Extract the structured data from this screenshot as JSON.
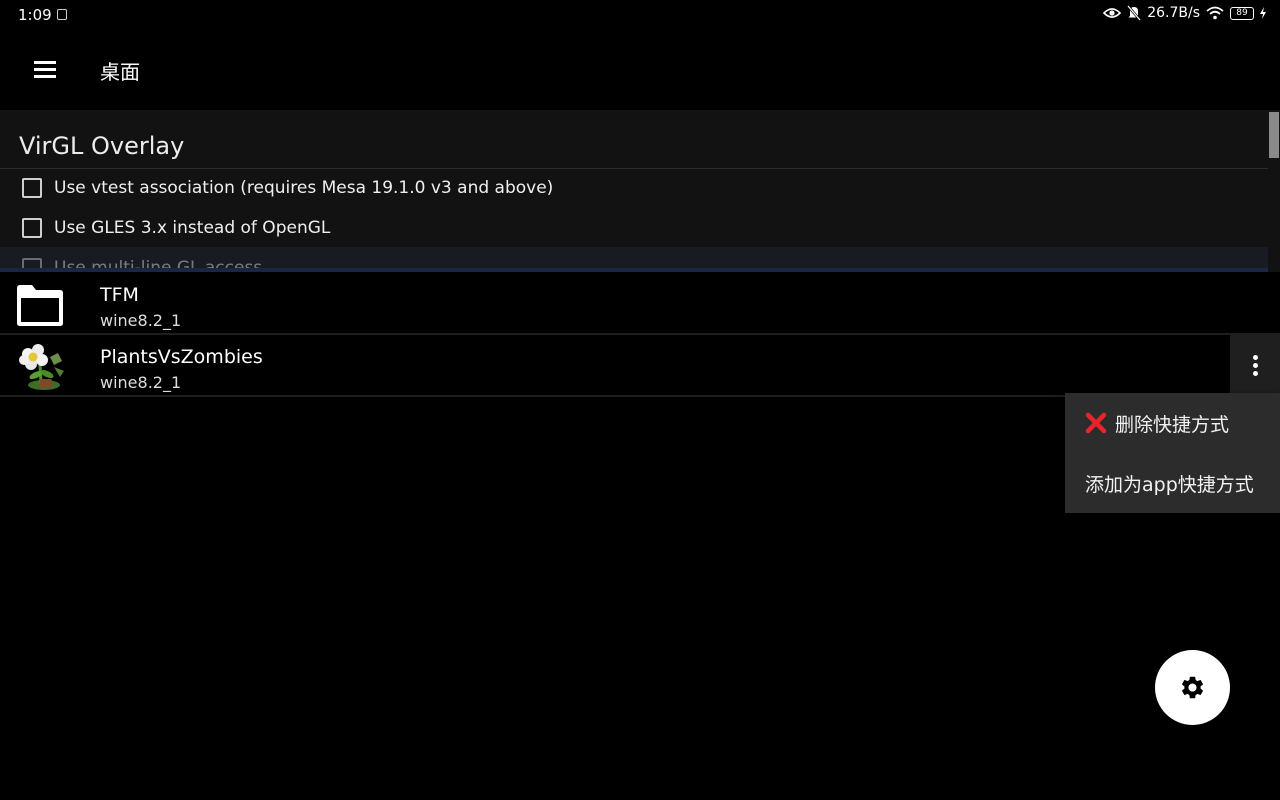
{
  "status_bar": {
    "time": "1:09",
    "net_speed": "26.7B/s",
    "battery": "89"
  },
  "toolbar": {
    "title": "桌面"
  },
  "overlay": {
    "title": "VirGL Overlay",
    "options": [
      {
        "label": "Use vtest association (requires Mesa 19.1.0 v3 and above)",
        "checked": false
      },
      {
        "label": "Use GLES 3.x instead of OpenGL",
        "checked": false
      },
      {
        "label": "Use multi-line GL access",
        "checked": false
      }
    ]
  },
  "items": [
    {
      "name": "TFM",
      "subtitle": "wine8.2_1",
      "icon": "folder-icon"
    },
    {
      "name": "PlantsVsZombies",
      "subtitle": "wine8.2_1",
      "icon": "plants-vs-zombies-icon"
    }
  ],
  "context_menu": {
    "items": [
      {
        "label": "删除快捷方式",
        "icon": "red-x-icon"
      },
      {
        "label": "添加为app快捷方式"
      }
    ]
  },
  "fab": {
    "icon": "gear-icon"
  },
  "colors": {
    "background": "#000000",
    "panel": "#121212",
    "menu": "#2c2c2c",
    "delete_red": "#e8252b"
  }
}
